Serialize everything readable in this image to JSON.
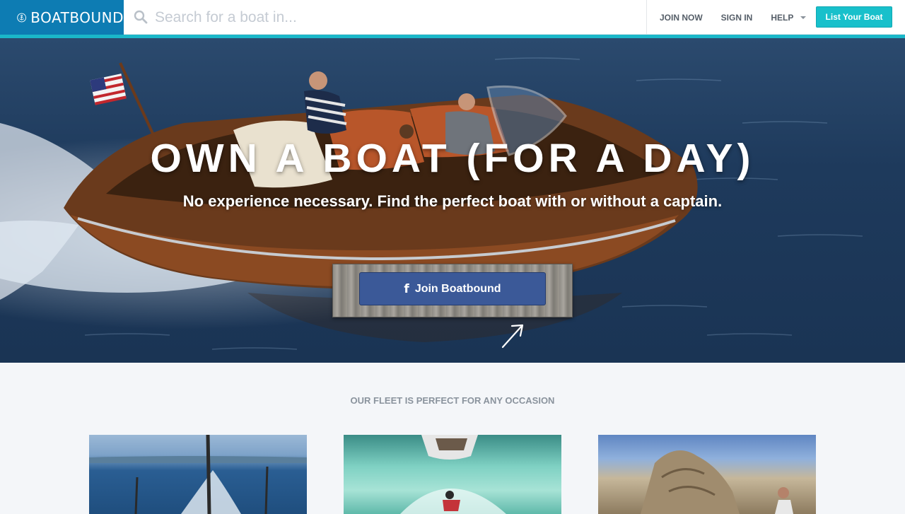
{
  "brand": {
    "name": "BOATBOUND"
  },
  "search": {
    "placeholder": "Search for a boat in..."
  },
  "nav": {
    "join": "JOIN NOW",
    "signin": "SIGN IN",
    "help": "HELP",
    "list_boat": "List Your Boat"
  },
  "hero": {
    "title": "OWN A BOAT (FOR A DAY)",
    "subtitle": "No experience necessary. Find the perfect boat with or without a captain.",
    "cta": "Join Boatbound",
    "cta_icon": "facebook-icon"
  },
  "fleet": {
    "title": "OUR FLEET IS PERFECT FOR ANY OCCASION"
  },
  "colors": {
    "brand_blue": "#0d7cb3",
    "accent_teal": "#1ab7c9",
    "facebook": "#3b5998"
  }
}
